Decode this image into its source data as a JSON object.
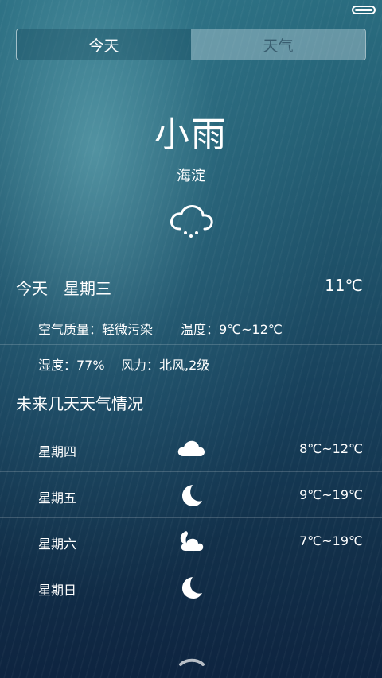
{
  "tabs": [
    {
      "label": "今天",
      "active": true
    },
    {
      "label": "天气",
      "active": false
    }
  ],
  "current": {
    "condition": "小雨",
    "location": "海淀",
    "icon": "cloud-light-rain-icon"
  },
  "today": {
    "label": "今天",
    "weekday": "星期三",
    "temperature": "11℃",
    "air_quality": "空气质量：轻微污染",
    "temp_range": "温度：9℃~12℃",
    "humidity": "湿度：77%",
    "wind": "风力：北风,2级"
  },
  "forecast": {
    "title": "未来几天天气情况",
    "days": [
      {
        "day": "星期四",
        "icon": "cloud-icon",
        "temp": "8℃~12℃"
      },
      {
        "day": "星期五",
        "icon": "moon-icon",
        "temp": "9℃~19℃"
      },
      {
        "day": "星期六",
        "icon": "moon-cloud-icon",
        "temp": "7℃~19℃"
      },
      {
        "day": "星期日",
        "icon": "moon-icon",
        "temp": ""
      }
    ]
  }
}
